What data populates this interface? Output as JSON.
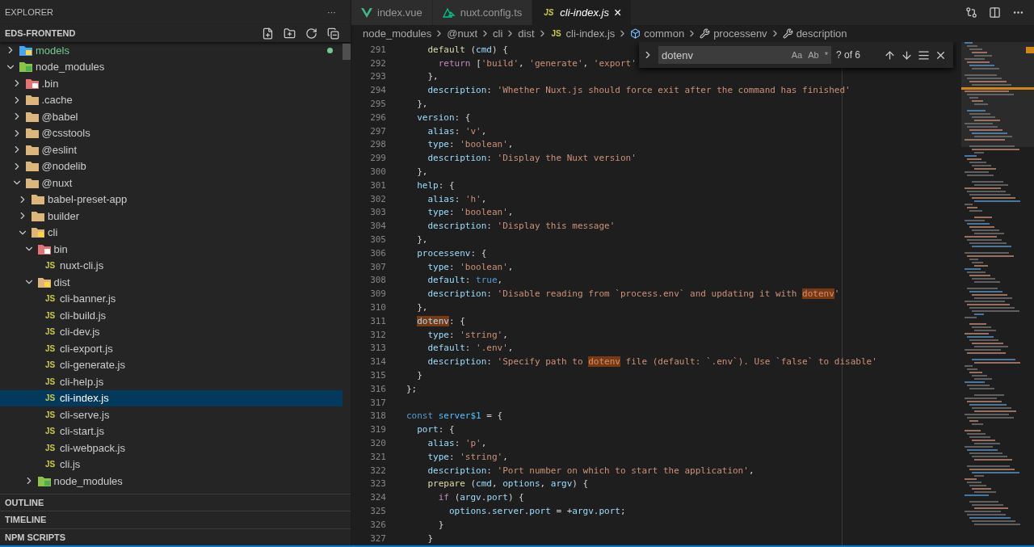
{
  "sidebar": {
    "title": "EXPLORER",
    "more": "···",
    "project": "EDS-FRONTEND",
    "tree": [
      {
        "label": "models",
        "kind": "model",
        "expanded": false,
        "selected": false,
        "color": "#73c991"
      },
      {
        "label": "node_modules",
        "kind": "node",
        "expanded": true,
        "selected": false,
        "children": [
          {
            "label": ".bin",
            "kind": "bin",
            "expanded": false,
            "selected": false
          },
          {
            "label": ".cache",
            "kind": "folder",
            "expanded": false,
            "selected": false
          },
          {
            "label": "@babel",
            "kind": "folder",
            "expanded": false,
            "selected": false
          },
          {
            "label": "@csstools",
            "kind": "folder",
            "expanded": false,
            "selected": false
          },
          {
            "label": "@eslint",
            "kind": "folder",
            "expanded": false,
            "selected": false
          },
          {
            "label": "@nodelib",
            "kind": "folder",
            "expanded": false,
            "selected": false
          },
          {
            "label": "@nuxt",
            "kind": "folder",
            "expanded": true,
            "selected": false,
            "children": [
              {
                "label": "babel-preset-app",
                "kind": "folder",
                "expanded": false,
                "selected": false
              },
              {
                "label": "builder",
                "kind": "folder",
                "expanded": false,
                "selected": false
              },
              {
                "label": "cli",
                "kind": "cli",
                "expanded": true,
                "selected": false,
                "children": [
                  {
                    "label": "bin",
                    "kind": "bin",
                    "expanded": true,
                    "selected": false,
                    "children": [
                      {
                        "label": "nuxt-cli.js",
                        "kind": "js",
                        "badge": "JS",
                        "selected": false
                      }
                    ]
                  },
                  {
                    "label": "dist",
                    "kind": "dist",
                    "expanded": true,
                    "selected": false,
                    "children": [
                      {
                        "label": "cli-banner.js",
                        "kind": "js",
                        "badge": "JS",
                        "selected": false
                      },
                      {
                        "label": "cli-build.js",
                        "kind": "js",
                        "badge": "JS",
                        "selected": false
                      },
                      {
                        "label": "cli-dev.js",
                        "kind": "js",
                        "badge": "JS",
                        "selected": false
                      },
                      {
                        "label": "cli-export.js",
                        "kind": "js",
                        "badge": "JS",
                        "selected": false
                      },
                      {
                        "label": "cli-generate.js",
                        "kind": "js",
                        "badge": "JS",
                        "selected": false
                      },
                      {
                        "label": "cli-help.js",
                        "kind": "js",
                        "badge": "JS",
                        "selected": false
                      },
                      {
                        "label": "cli-index.js",
                        "kind": "js",
                        "badge": "JS",
                        "selected": true
                      },
                      {
                        "label": "cli-serve.js",
                        "kind": "js",
                        "badge": "JS",
                        "selected": false
                      },
                      {
                        "label": "cli-start.js",
                        "kind": "js",
                        "badge": "JS",
                        "selected": false
                      },
                      {
                        "label": "cli-webpack.js",
                        "kind": "js",
                        "badge": "JS",
                        "selected": false
                      },
                      {
                        "label": "cli.js",
                        "kind": "js",
                        "badge": "JS",
                        "selected": false
                      }
                    ]
                  },
                  {
                    "label": "node_modules",
                    "kind": "node",
                    "expanded": false,
                    "selected": false
                  }
                ]
              }
            ]
          }
        ]
      }
    ],
    "panels": [
      "OUTLINE",
      "TIMELINE",
      "NPM SCRIPTS"
    ]
  },
  "tabs": [
    {
      "label": "index.vue",
      "kind": "vue",
      "selected": false
    },
    {
      "label": "nuxt.config.ts",
      "kind": "nuxt",
      "selected": false
    },
    {
      "label": "cli-index.js",
      "kind": "js",
      "badge": "JS",
      "selected": true,
      "close": "×"
    }
  ],
  "breadcrumbs": [
    {
      "label": "node_modules",
      "kind": "plain"
    },
    {
      "label": "@nuxt",
      "kind": "plain"
    },
    {
      "label": "cli",
      "kind": "plain"
    },
    {
      "label": "dist",
      "kind": "plain"
    },
    {
      "label": "cli-index.js",
      "kind": "js",
      "badge": "JS"
    },
    {
      "label": "common",
      "kind": "symbol"
    },
    {
      "label": "processenv",
      "kind": "wrench"
    },
    {
      "label": "description",
      "kind": "wrench"
    }
  ],
  "find": {
    "value": "dotenv",
    "options": [
      "Aa",
      "Ab",
      "*"
    ],
    "result": "? of 6"
  },
  "code": [
    {
      "number": "291",
      "tokens": [
        {
          "kind": "fn",
          "text": "    default"
        },
        {
          "kind": "plain",
          "text": " ("
        },
        {
          "kind": "key",
          "text": "cmd"
        },
        {
          "kind": "plain",
          "text": ") {"
        }
      ]
    },
    {
      "number": "292",
      "tokens": [
        {
          "kind": "ctrl",
          "text": "      return"
        },
        {
          "kind": "plain",
          "text": " ["
        },
        {
          "kind": "str",
          "text": "'build'"
        },
        {
          "kind": "plain",
          "text": ", "
        },
        {
          "kind": "str",
          "text": "'generate'"
        },
        {
          "kind": "plain",
          "text": ", "
        },
        {
          "kind": "str",
          "text": "'export'"
        }
      ]
    },
    {
      "number": "293",
      "tokens": [
        {
          "kind": "plain",
          "text": "    },"
        }
      ]
    },
    {
      "number": "294",
      "tokens": [
        {
          "kind": "key",
          "text": "    description"
        },
        {
          "kind": "plain",
          "text": ": "
        },
        {
          "kind": "str",
          "text": "'Whether Nuxt.js should force exit after the command has finished'"
        }
      ]
    },
    {
      "number": "295",
      "tokens": [
        {
          "kind": "plain",
          "text": "  },"
        }
      ]
    },
    {
      "number": "296",
      "tokens": [
        {
          "kind": "key",
          "text": "  version"
        },
        {
          "kind": "plain",
          "text": ": {"
        }
      ]
    },
    {
      "number": "297",
      "tokens": [
        {
          "kind": "key",
          "text": "    alias"
        },
        {
          "kind": "plain",
          "text": ": "
        },
        {
          "kind": "str",
          "text": "'v'"
        },
        {
          "kind": "plain",
          "text": ","
        }
      ]
    },
    {
      "number": "298",
      "tokens": [
        {
          "kind": "key",
          "text": "    type"
        },
        {
          "kind": "plain",
          "text": ": "
        },
        {
          "kind": "str",
          "text": "'boolean'"
        },
        {
          "kind": "plain",
          "text": ","
        }
      ]
    },
    {
      "number": "299",
      "tokens": [
        {
          "kind": "key",
          "text": "    description"
        },
        {
          "kind": "plain",
          "text": ": "
        },
        {
          "kind": "str",
          "text": "'Display the Nuxt version'"
        }
      ]
    },
    {
      "number": "300",
      "tokens": [
        {
          "kind": "plain",
          "text": "  },"
        }
      ]
    },
    {
      "number": "301",
      "tokens": [
        {
          "kind": "key",
          "text": "  help"
        },
        {
          "kind": "plain",
          "text": ": {"
        }
      ]
    },
    {
      "number": "302",
      "tokens": [
        {
          "kind": "key",
          "text": "    alias"
        },
        {
          "kind": "plain",
          "text": ": "
        },
        {
          "kind": "str",
          "text": "'h'"
        },
        {
          "kind": "plain",
          "text": ","
        }
      ]
    },
    {
      "number": "303",
      "tokens": [
        {
          "kind": "key",
          "text": "    type"
        },
        {
          "kind": "plain",
          "text": ": "
        },
        {
          "kind": "str",
          "text": "'boolean'"
        },
        {
          "kind": "plain",
          "text": ","
        }
      ]
    },
    {
      "number": "304",
      "tokens": [
        {
          "kind": "key",
          "text": "    description"
        },
        {
          "kind": "plain",
          "text": ": "
        },
        {
          "kind": "str",
          "text": "'Display this message'"
        }
      ]
    },
    {
      "number": "305",
      "tokens": [
        {
          "kind": "plain",
          "text": "  },"
        }
      ]
    },
    {
      "number": "306",
      "tokens": [
        {
          "kind": "key",
          "text": "  processenv"
        },
        {
          "kind": "plain",
          "text": ": {"
        }
      ]
    },
    {
      "number": "307",
      "tokens": [
        {
          "kind": "key",
          "text": "    type"
        },
        {
          "kind": "plain",
          "text": ": "
        },
        {
          "kind": "str",
          "text": "'boolean'"
        },
        {
          "kind": "plain",
          "text": ","
        }
      ]
    },
    {
      "number": "308",
      "tokens": [
        {
          "kind": "key",
          "text": "    default"
        },
        {
          "kind": "plain",
          "text": ": "
        },
        {
          "kind": "kw",
          "text": "true"
        },
        {
          "kind": "plain",
          "text": ","
        }
      ]
    },
    {
      "number": "309",
      "tokens": [
        {
          "kind": "key",
          "text": "    description"
        },
        {
          "kind": "plain",
          "text": ": "
        },
        {
          "kind": "str",
          "text": "'Disable reading from `process.env` and updating it with "
        },
        {
          "kind": "match-str",
          "text": "dotenv"
        },
        {
          "kind": "str",
          "text": "'"
        }
      ]
    },
    {
      "number": "310",
      "tokens": [
        {
          "kind": "plain",
          "text": "  },"
        }
      ]
    },
    {
      "number": "311",
      "tokens": [
        {
          "kind": "match-key",
          "text": "  dotenv"
        },
        {
          "kind": "plain",
          "text": ": {"
        }
      ]
    },
    {
      "number": "312",
      "tokens": [
        {
          "kind": "key",
          "text": "    type"
        },
        {
          "kind": "plain",
          "text": ": "
        },
        {
          "kind": "str",
          "text": "'string'"
        },
        {
          "kind": "plain",
          "text": ","
        }
      ]
    },
    {
      "number": "313",
      "tokens": [
        {
          "kind": "key",
          "text": "    default"
        },
        {
          "kind": "plain",
          "text": ": "
        },
        {
          "kind": "str",
          "text": "'.env'"
        },
        {
          "kind": "plain",
          "text": ","
        }
      ]
    },
    {
      "number": "314",
      "tokens": [
        {
          "kind": "key",
          "text": "    description"
        },
        {
          "kind": "plain",
          "text": ": "
        },
        {
          "kind": "str",
          "text": "'Specify path to "
        },
        {
          "kind": "match-str",
          "text": "dotenv"
        },
        {
          "kind": "str",
          "text": " file (default: `.env`). Use `false` to disable'"
        }
      ]
    },
    {
      "number": "315",
      "tokens": [
        {
          "kind": "plain",
          "text": "  }"
        }
      ]
    },
    {
      "number": "316",
      "tokens": [
        {
          "kind": "plain",
          "text": "};"
        }
      ]
    },
    {
      "number": "317"
    },
    {
      "number": "318",
      "tokens": [
        {
          "kind": "kw",
          "text": "const"
        },
        {
          "kind": "var",
          "text": " server$1"
        },
        {
          "kind": "plain",
          "text": " = {"
        }
      ]
    },
    {
      "number": "319",
      "tokens": [
        {
          "kind": "key",
          "text": "  port"
        },
        {
          "kind": "plain",
          "text": ": {"
        }
      ]
    },
    {
      "number": "320",
      "tokens": [
        {
          "kind": "key",
          "text": "    alias"
        },
        {
          "kind": "plain",
          "text": ": "
        },
        {
          "kind": "str",
          "text": "'p'"
        },
        {
          "kind": "plain",
          "text": ","
        }
      ]
    },
    {
      "number": "321",
      "tokens": [
        {
          "kind": "key",
          "text": "    type"
        },
        {
          "kind": "plain",
          "text": ": "
        },
        {
          "kind": "str",
          "text": "'string'"
        },
        {
          "kind": "plain",
          "text": ","
        }
      ]
    },
    {
      "number": "322",
      "tokens": [
        {
          "kind": "key",
          "text": "    description"
        },
        {
          "kind": "plain",
          "text": ": "
        },
        {
          "kind": "str",
          "text": "'Port number on which to start the application'"
        },
        {
          "kind": "plain",
          "text": ","
        }
      ]
    },
    {
      "number": "323",
      "tokens": [
        {
          "kind": "fn",
          "text": "    prepare"
        },
        {
          "kind": "plain",
          "text": " ("
        },
        {
          "kind": "key",
          "text": "cmd"
        },
        {
          "kind": "plain",
          "text": ", "
        },
        {
          "kind": "key",
          "text": "options"
        },
        {
          "kind": "plain",
          "text": ", "
        },
        {
          "kind": "key",
          "text": "argv"
        },
        {
          "kind": "plain",
          "text": ") {"
        }
      ]
    },
    {
      "number": "324",
      "tokens": [
        {
          "kind": "ctrl",
          "text": "      if"
        },
        {
          "kind": "plain",
          "text": " ("
        },
        {
          "kind": "key",
          "text": "argv"
        },
        {
          "kind": "plain",
          "text": "."
        },
        {
          "kind": "key",
          "text": "port"
        },
        {
          "kind": "plain",
          "text": ") {"
        }
      ]
    },
    {
      "number": "325",
      "tokens": [
        {
          "kind": "key",
          "text": "        options"
        },
        {
          "kind": "plain",
          "text": "."
        },
        {
          "kind": "key",
          "text": "server"
        },
        {
          "kind": "plain",
          "text": "."
        },
        {
          "kind": "key",
          "text": "port"
        },
        {
          "kind": "plain",
          "text": " = +"
        },
        {
          "kind": "key",
          "text": "argv"
        },
        {
          "kind": "plain",
          "text": "."
        },
        {
          "kind": "key",
          "text": "port"
        },
        {
          "kind": "plain",
          "text": ";"
        }
      ]
    },
    {
      "number": "326",
      "tokens": [
        {
          "kind": "plain",
          "text": "      }"
        }
      ]
    },
    {
      "number": "327",
      "tokens": [
        {
          "kind": "plain",
          "text": "    }"
        }
      ]
    }
  ]
}
